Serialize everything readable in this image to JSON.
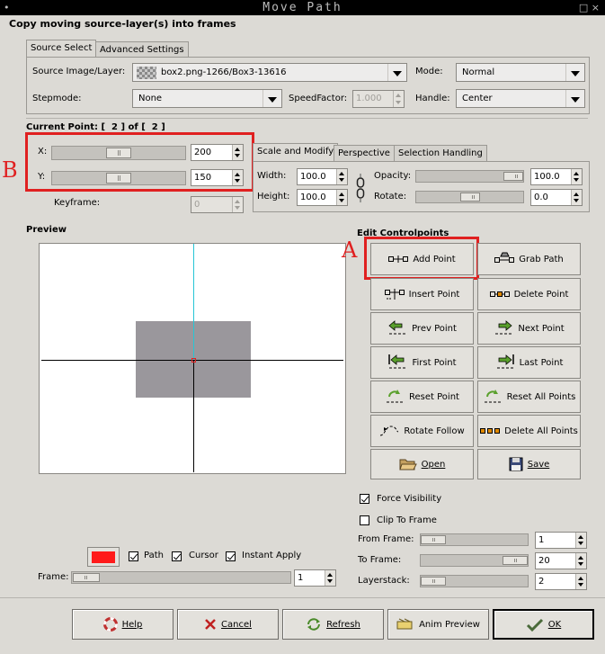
{
  "window": {
    "title": "Move Path",
    "menu_glyph": "•",
    "ctl_glyphs": "□ ×"
  },
  "heading": "Copy moving source-layer(s) into frames",
  "tabs_top": [
    "Source Select",
    "Advanced Settings"
  ],
  "source": {
    "image_label": "Source Image/Layer:",
    "image_value": "box2.png-1266/Box3-13616",
    "mode_label": "Mode:",
    "mode_value": "Normal",
    "stepmode_label": "Stepmode:",
    "stepmode_value": "None",
    "speed_label": "SpeedFactor:",
    "speed_value": "1.000",
    "handle_label": "Handle:",
    "handle_value": "Center"
  },
  "current_point": "Current Point: [  2 ] of [  2 ]",
  "coords": {
    "x_label": "X:",
    "x_value": "200",
    "x_level": 0.5,
    "y_label": "Y:",
    "y_value": "150",
    "y_level": 0.5,
    "keyframe_label": "Keyframe:",
    "keyframe_value": "0"
  },
  "tabs_mid": [
    "Scale and Modify",
    "Perspective",
    "Selection Handling"
  ],
  "scale": {
    "width_label": "Width:",
    "width_value": "100.0",
    "height_label": "Height:",
    "height_value": "100.0",
    "opacity_label": "Opacity:",
    "opacity_value": "100.0",
    "rotate_label": "Rotate:",
    "rotate_value": "0.0"
  },
  "preview_label": "Preview",
  "edit_label": "Edit Controlpoints",
  "buttons": {
    "add_point": "Add Point",
    "grab_path": "Grab Path",
    "insert_point": "Insert Point",
    "delete_point": "Delete Point",
    "prev_point": "Prev Point",
    "next_point": "Next Point",
    "first_point": "First Point",
    "last_point": "Last Point",
    "reset_point": "Reset Point",
    "reset_all_points": "Reset All Points",
    "rotate_follow": "Rotate Follow",
    "delete_all_points": "Delete All Points",
    "open": "Open",
    "save": "Save"
  },
  "checks": {
    "path": "Path",
    "cursor": "Cursor",
    "instant_apply": "Instant Apply",
    "force_visibility": "Force Visibility",
    "clip_to_frame": "Clip To Frame"
  },
  "frame": {
    "label": "Frame:",
    "value": "1"
  },
  "ranges": {
    "from_label": "From Frame:",
    "from_value": "1",
    "to_label": "To Frame:",
    "to_value": "20",
    "layerstack_label": "Layerstack:",
    "layerstack_value": "2"
  },
  "footer": {
    "help": "Help",
    "cancel": "Cancel",
    "refresh": "Refresh",
    "anim_preview": "Anim Preview",
    "ok": "OK"
  },
  "annotations": {
    "a": "A",
    "b": "B"
  },
  "colors": {
    "path_color": "#ff1a1a",
    "annotation": "#e02020",
    "cursor_line": "#26c6d6"
  }
}
